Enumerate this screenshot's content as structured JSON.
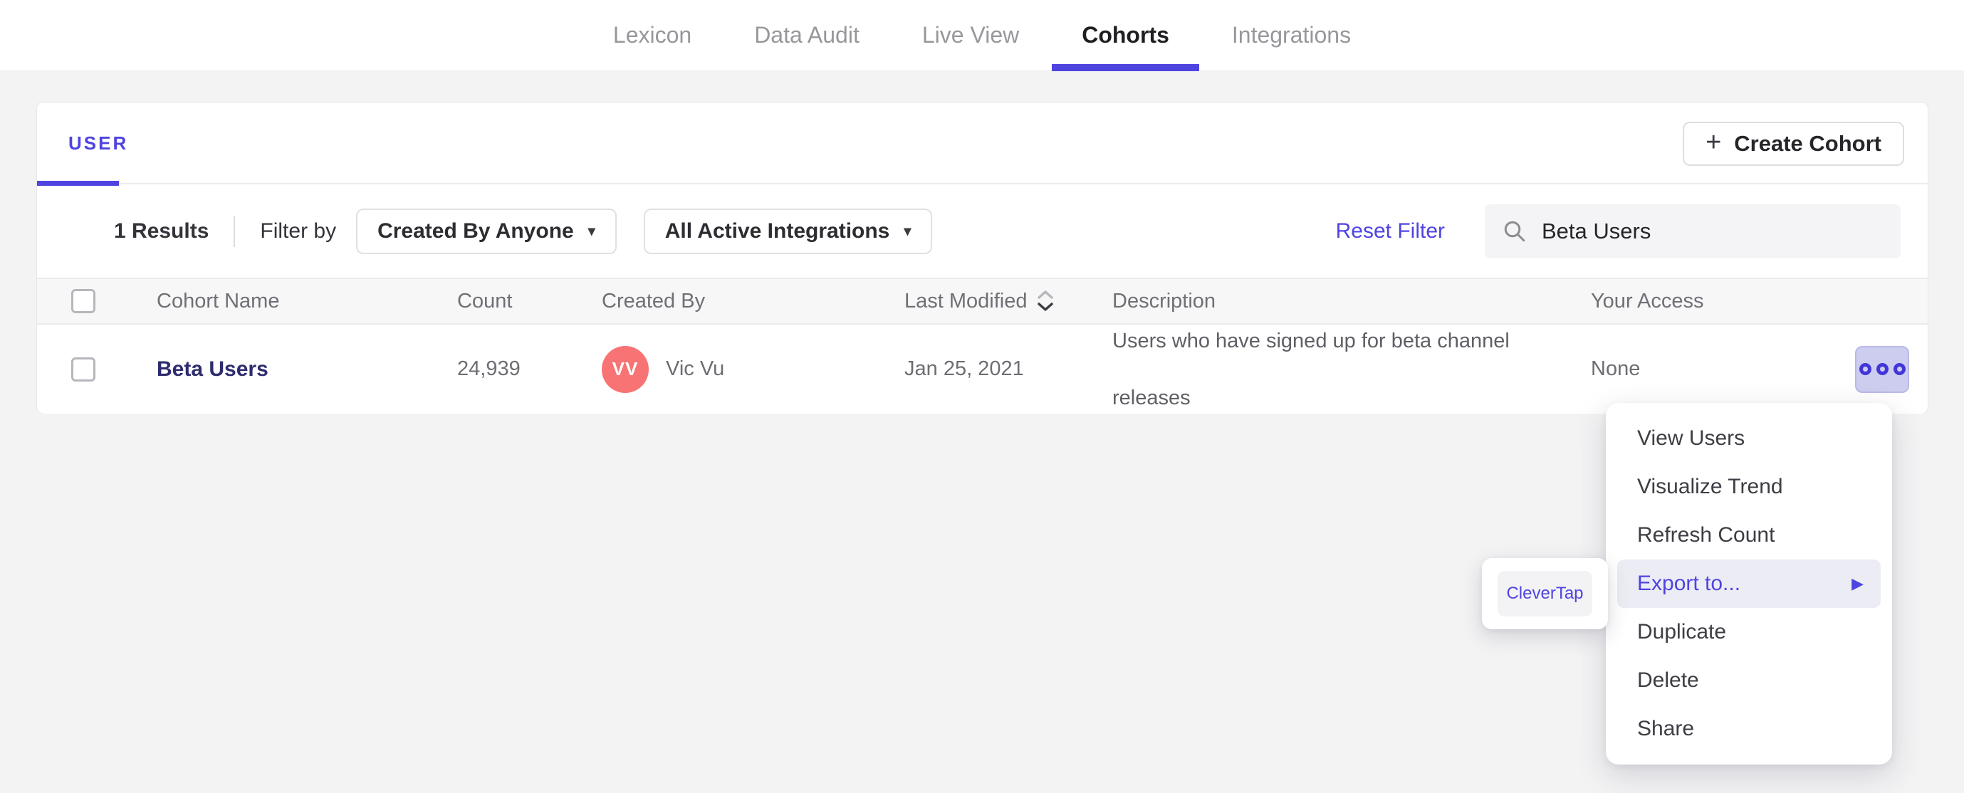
{
  "nav": {
    "items": [
      "Lexicon",
      "Data Audit",
      "Live View",
      "Cohorts",
      "Integrations"
    ],
    "active": "Cohorts"
  },
  "card": {
    "tab_label": "USER",
    "create_button": {
      "plus": "+",
      "label": "Create Cohort"
    },
    "filters": {
      "results": "1 Results",
      "filter_by": "Filter by",
      "created_by_dropdown": "Created By Anyone",
      "integrations_dropdown": "All Active Integrations",
      "caret": "▾",
      "reset": "Reset Filter",
      "search_value": "Beta Users"
    },
    "table": {
      "headers": [
        "Cohort Name",
        "Count",
        "Created By",
        "Last Modified",
        "Description",
        "Your Access"
      ],
      "row": {
        "name": "Beta Users",
        "count": "24,939",
        "avatar_initials": "VV",
        "created_by": "Vic Vu",
        "last_modified": "Jan 25, 2021",
        "description_line1": "Users who have signed up for beta channel",
        "description_line2": "releases",
        "access": "None"
      }
    }
  },
  "menu": {
    "items": [
      "View Users",
      "Visualize Trend",
      "Refresh Count",
      "Export to...",
      "Duplicate",
      "Delete",
      "Share"
    ],
    "submenu_arrow": "▶"
  },
  "submenu": {
    "label": "CleverTap"
  },
  "colors": {
    "accent": "#4f44e0",
    "cohort_link": "#2e2c6e",
    "avatar_bg": "#f87373",
    "action_button_bg": "#cdcdf0",
    "menu_highlight_bg": "#ececf5"
  }
}
